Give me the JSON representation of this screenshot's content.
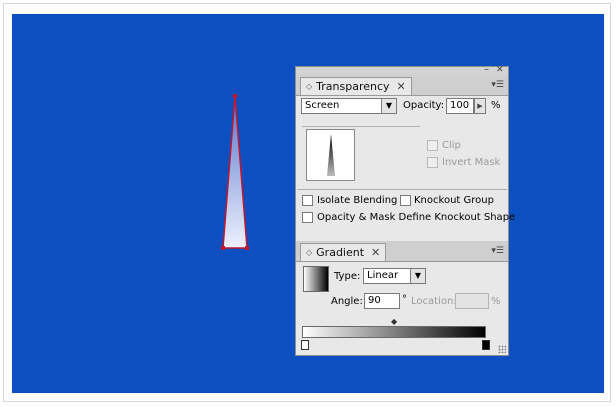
{
  "colors": {
    "canvas": "#0b4fc1",
    "shape_stroke": "#c0182e",
    "shape_fill_top": "#5472c9",
    "shape_fill_bottom": "#eef2ff",
    "panel_bg": "#e8e8e8"
  },
  "transparency": {
    "tab_label": "Transparency",
    "close_glyph": "✕",
    "blend_mode": "Screen",
    "opacity_label": "Opacity:",
    "opacity_value": "100",
    "percent": "%",
    "clip_label": "Clip",
    "invert_mask_label": "Invert Mask",
    "isolate_blending_label": "Isolate Blending",
    "knockout_group_label": "Knockout Group",
    "opacity_mask_label": "Opacity & Mask Define Knockout Shape"
  },
  "gradient": {
    "tab_label": "Gradient",
    "close_glyph": "✕",
    "type_label": "Type:",
    "type_value": "Linear",
    "angle_label": "Angle:",
    "angle_value": "90",
    "degree": "°",
    "location_label": "Location:",
    "location_value": "",
    "percent": "%"
  },
  "icons": {
    "minimize": "–",
    "close": "✕",
    "menu": "▾☰",
    "dropdown": "▼",
    "spin": "▶",
    "diamond": "◇",
    "midpoint": "◆"
  }
}
